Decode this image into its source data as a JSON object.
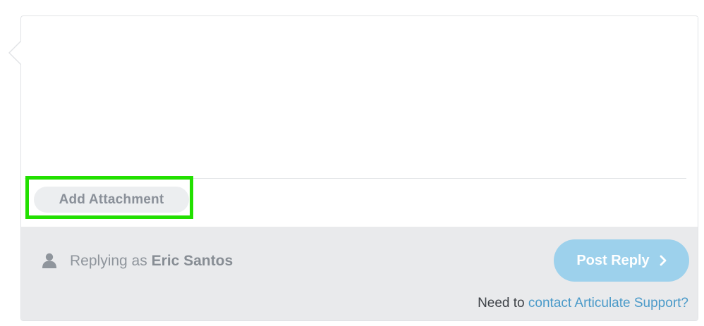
{
  "editor": {
    "add_attachment_label": "Add Attachment"
  },
  "footer": {
    "replying_prefix": "Replying as",
    "user_name": "Eric Santos",
    "post_reply_label": "Post Reply",
    "support_prefix": "Need to",
    "support_link_label": "contact Articulate Support?"
  },
  "colors": {
    "highlight": "#22e000",
    "post_button": "#9dd1ec",
    "link": "#4a9ac9",
    "footer_bg": "#e9eaec"
  },
  "icons": {
    "user": "user-icon",
    "post_arrow": "chevron-right-icon"
  }
}
